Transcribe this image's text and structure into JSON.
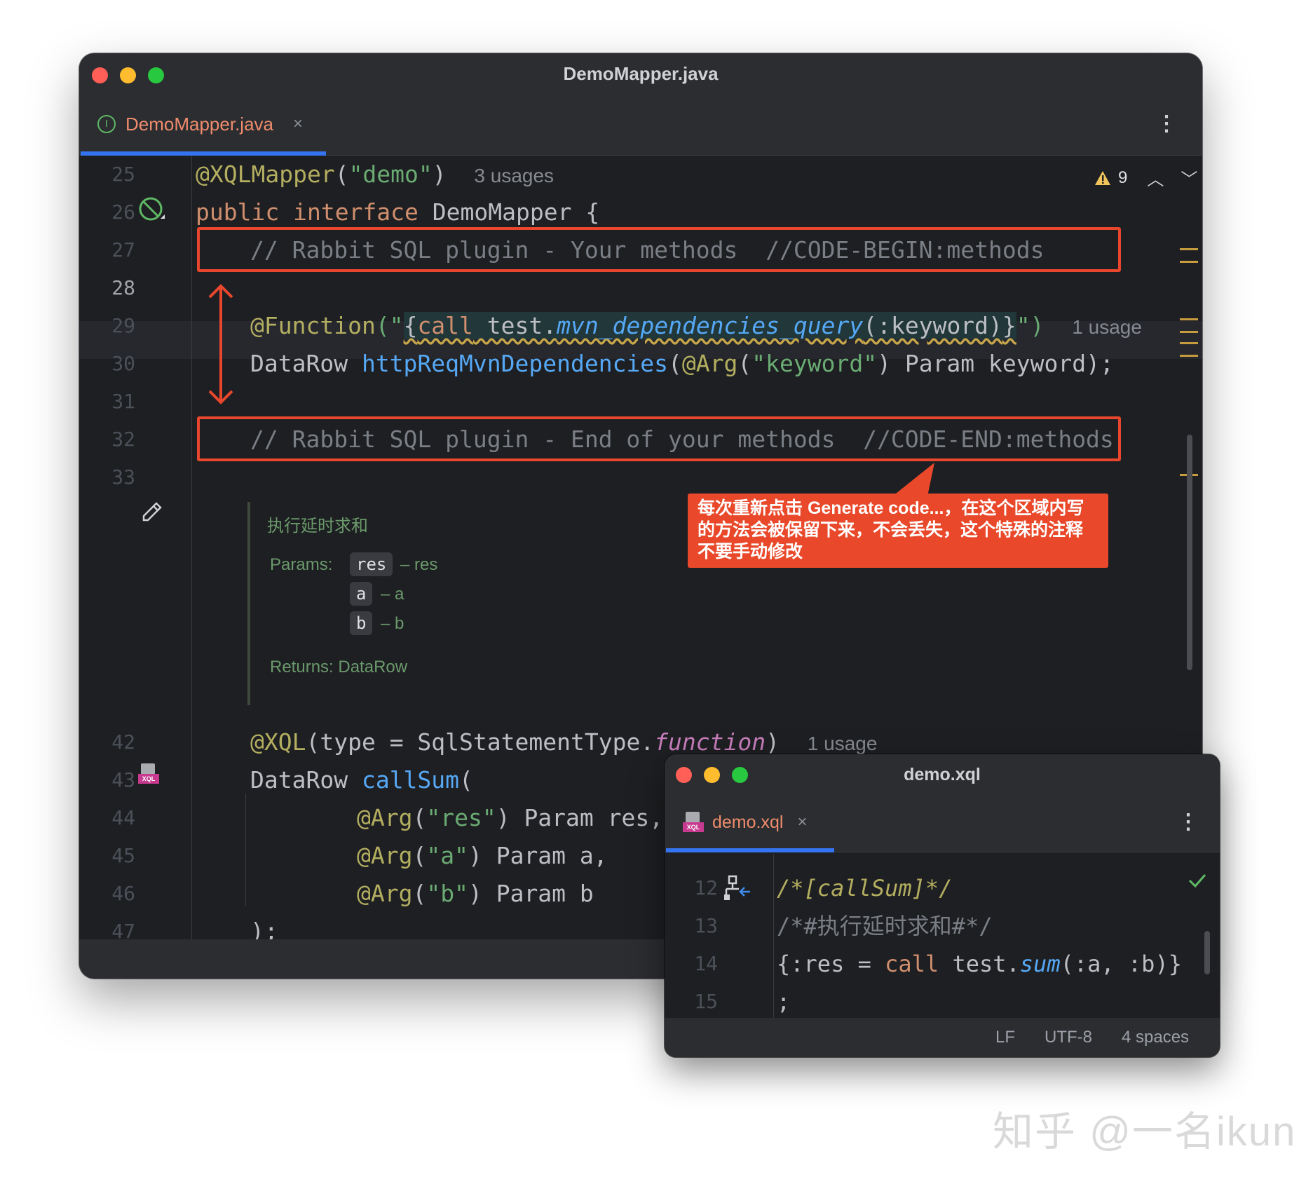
{
  "main_window": {
    "title": "DemoMapper.java",
    "tab": {
      "label": "DemoMapper.java",
      "close": "×",
      "icon": "interface-icon"
    },
    "inspection": {
      "warning_count": "9"
    },
    "line_numbers": [
      "25",
      "26",
      "27",
      "28",
      "29",
      "30",
      "31",
      "32",
      "33",
      "42",
      "43",
      "44",
      "45",
      "46",
      "47"
    ],
    "code": {
      "l25_annotation": "@XQLMapper",
      "l25_paren_open": "(",
      "l25_string": "\"demo\"",
      "l25_paren_close": ")",
      "l25_usages": "3 usages",
      "l26_public": "public",
      "l26_interface": "interface",
      "l26_rest": " DemoMapper {",
      "l27_comment": "// Rabbit SQL plugin - Your methods  //CODE-BEGIN:methods",
      "l29_annotation": "@Function",
      "l29_open": "(\"",
      "l29_call_open": "{",
      "l29_call": "call",
      "l29_test": " test.",
      "l29_proc": "mvn_dependencies_query",
      "l29_param": "(:keyword)",
      "l29_call_close": "}",
      "l29_close": "\")",
      "l29_usage": "1 usage",
      "l30_type": "DataRow ",
      "l30_method": "httpReqMvnDependencies",
      "l30_open": "(",
      "l30_arg_ann": "@Arg",
      "l30_arg_open": "(",
      "l30_arg_str": "\"keyword\"",
      "l30_rest": ") Param keyword);",
      "l32_comment": "// Rabbit SQL plugin - End of your methods  //CODE-END:methods",
      "l42_annotation": "@XQL",
      "l42_mid": "(type = SqlStatementType.",
      "l42_const": "function",
      "l42_close": ")",
      "l42_usage": "1 usage",
      "l43_type": "DataRow ",
      "l43_method": "callSum",
      "l43_open": "(",
      "l44_ann": "@Arg",
      "l44_open": "(",
      "l44_str": "\"res\"",
      "l44_rest": ") Param res,",
      "l45_ann": "@Arg",
      "l45_open": "(",
      "l45_str": "\"a\"",
      "l45_rest": ") Param a,",
      "l46_ann": "@Arg",
      "l46_open": "(",
      "l46_str": "\"b\"",
      "l46_rest": ") Param b",
      "l47": ");"
    },
    "doc": {
      "title": "执行延时求和",
      "params_label": "Params:",
      "params": [
        {
          "name": "res",
          "desc": "– res"
        },
        {
          "name": "a",
          "desc": "– a"
        },
        {
          "name": "b",
          "desc": "– b"
        }
      ],
      "returns": "Returns: DataRow"
    },
    "callout": "每次重新点击 Generate code...，在这个区域内写的方法会被保留下来，不会丢失，这个特殊的注释不要手动修改"
  },
  "xql_window": {
    "title": "demo.xql",
    "tab": {
      "label": "demo.xql",
      "close": "×",
      "icon_text": "XQL"
    },
    "line_numbers": [
      "12",
      "13",
      "14",
      "15"
    ],
    "code": {
      "l12": "/*[callSum]*/",
      "l13": "/*#执行延时求和#*/",
      "l14_open": "{:res = ",
      "l14_call": "call",
      "l14_test": " test.",
      "l14_sum": "sum",
      "l14_rest": "(:a, :b)}",
      "l15": ";"
    },
    "status": {
      "line_sep": "LF",
      "encoding": "UTF-8",
      "indent": "4 spaces"
    }
  },
  "watermark": "知乎 @一名ikun",
  "colors": {
    "editor_bg": "#1e1f22",
    "keyword": "#cf8e6d",
    "annotation": "#b3ae60",
    "string": "#6aab73",
    "method": "#56a8f5",
    "highlight_box": "#e8472d",
    "callout_bg": "#e9492a",
    "tab_underline": "#3574f0"
  }
}
